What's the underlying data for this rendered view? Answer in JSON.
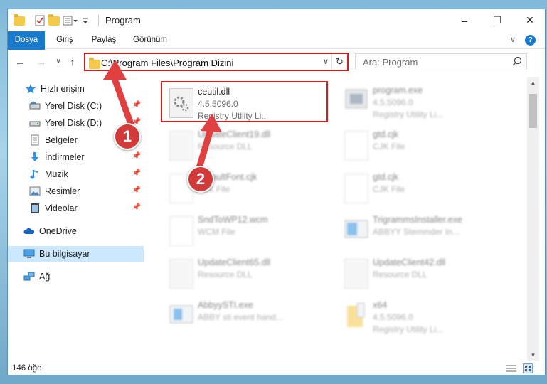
{
  "window": {
    "title": "Program",
    "controls": [
      "–",
      "☐",
      "✕"
    ]
  },
  "ribbon": {
    "tabs": [
      "Dosya",
      "Giriş",
      "Paylaş",
      "Görünüm"
    ],
    "help": "?",
    "chevron": "∨"
  },
  "nav": {
    "back": "←",
    "forward": "→",
    "recent": "∨",
    "up": "↑",
    "address": "C:\\Program Files\\Program Dizini",
    "search_placeholder": "Ara: Program"
  },
  "sidebar": {
    "items": [
      {
        "label": "Hızlı erişim",
        "icon": "star-icon"
      },
      {
        "label": "Yerel Disk (C:)",
        "icon": "drive-icon",
        "pinned": true
      },
      {
        "label": "Yerel Disk (D:)",
        "icon": "drive-icon",
        "pinned": true
      },
      {
        "label": "Belgeler",
        "icon": "documents-icon",
        "pinned": true
      },
      {
        "label": "İndirmeler",
        "icon": "download-icon",
        "pinned": true
      },
      {
        "label": "Müzik",
        "icon": "music-icon",
        "pinned": true
      },
      {
        "label": "Resimler",
        "icon": "pictures-icon",
        "pinned": true
      },
      {
        "label": "Videolar",
        "icon": "videos-icon",
        "pinned": true
      },
      {
        "label": "OneDrive",
        "icon": "onedrive-icon"
      },
      {
        "label": "Bu bilgisayar",
        "icon": "computer-icon",
        "selected": true
      },
      {
        "label": "Ağ",
        "icon": "network-icon"
      }
    ]
  },
  "files": [
    {
      "name": "ceutil.dll",
      "line2": "4.5.5096.0",
      "line3": "Registry Utility Li...",
      "type": "gear",
      "highlighted": true
    },
    {
      "name": "program.exe",
      "line2": "4.5.5096.0",
      "line3": "Registry Utility Li...",
      "type": "exe"
    },
    {
      "name": "UpdateClient19.dll",
      "line2": "Resource DLL",
      "line3": "",
      "type": "gear"
    },
    {
      "name": "gtd.cjk",
      "line2": "CJK File",
      "line3": "",
      "type": "doc"
    },
    {
      "name": "DefaultFont.cjk",
      "line2": "CJK File",
      "line3": "",
      "type": "doc"
    },
    {
      "name": "gtd.cjk",
      "line2": "CJK File",
      "line3": "",
      "type": "doc"
    },
    {
      "name": "SndToWP12.wcm",
      "line2": "WCM File",
      "line3": "",
      "type": "doc"
    },
    {
      "name": "TrigrammsInstaller.exe",
      "line2": "ABBYY Stemmder In...",
      "line3": "",
      "type": "exe"
    },
    {
      "name": "UpdateClient65.dll",
      "line2": "Resource DLL",
      "line3": "",
      "type": "gear"
    },
    {
      "name": "UpdateClient42.dll",
      "line2": "Resource DLL",
      "line3": "",
      "type": "gear"
    },
    {
      "name": "AbbyySTI.exe",
      "line2": "ABBY sti event hand...",
      "line3": "",
      "type": "exe"
    },
    {
      "name": "x64",
      "line2": "4.5.5096.0",
      "line3": "Registry Utility Li...",
      "type": "folder"
    }
  ],
  "status": {
    "count": "146 öğe"
  },
  "annotations": [
    "1",
    "2"
  ],
  "colors": {
    "accent": "#1979ca",
    "highlight_red": "#d41f1f",
    "selected_bg": "#cce8ff"
  }
}
